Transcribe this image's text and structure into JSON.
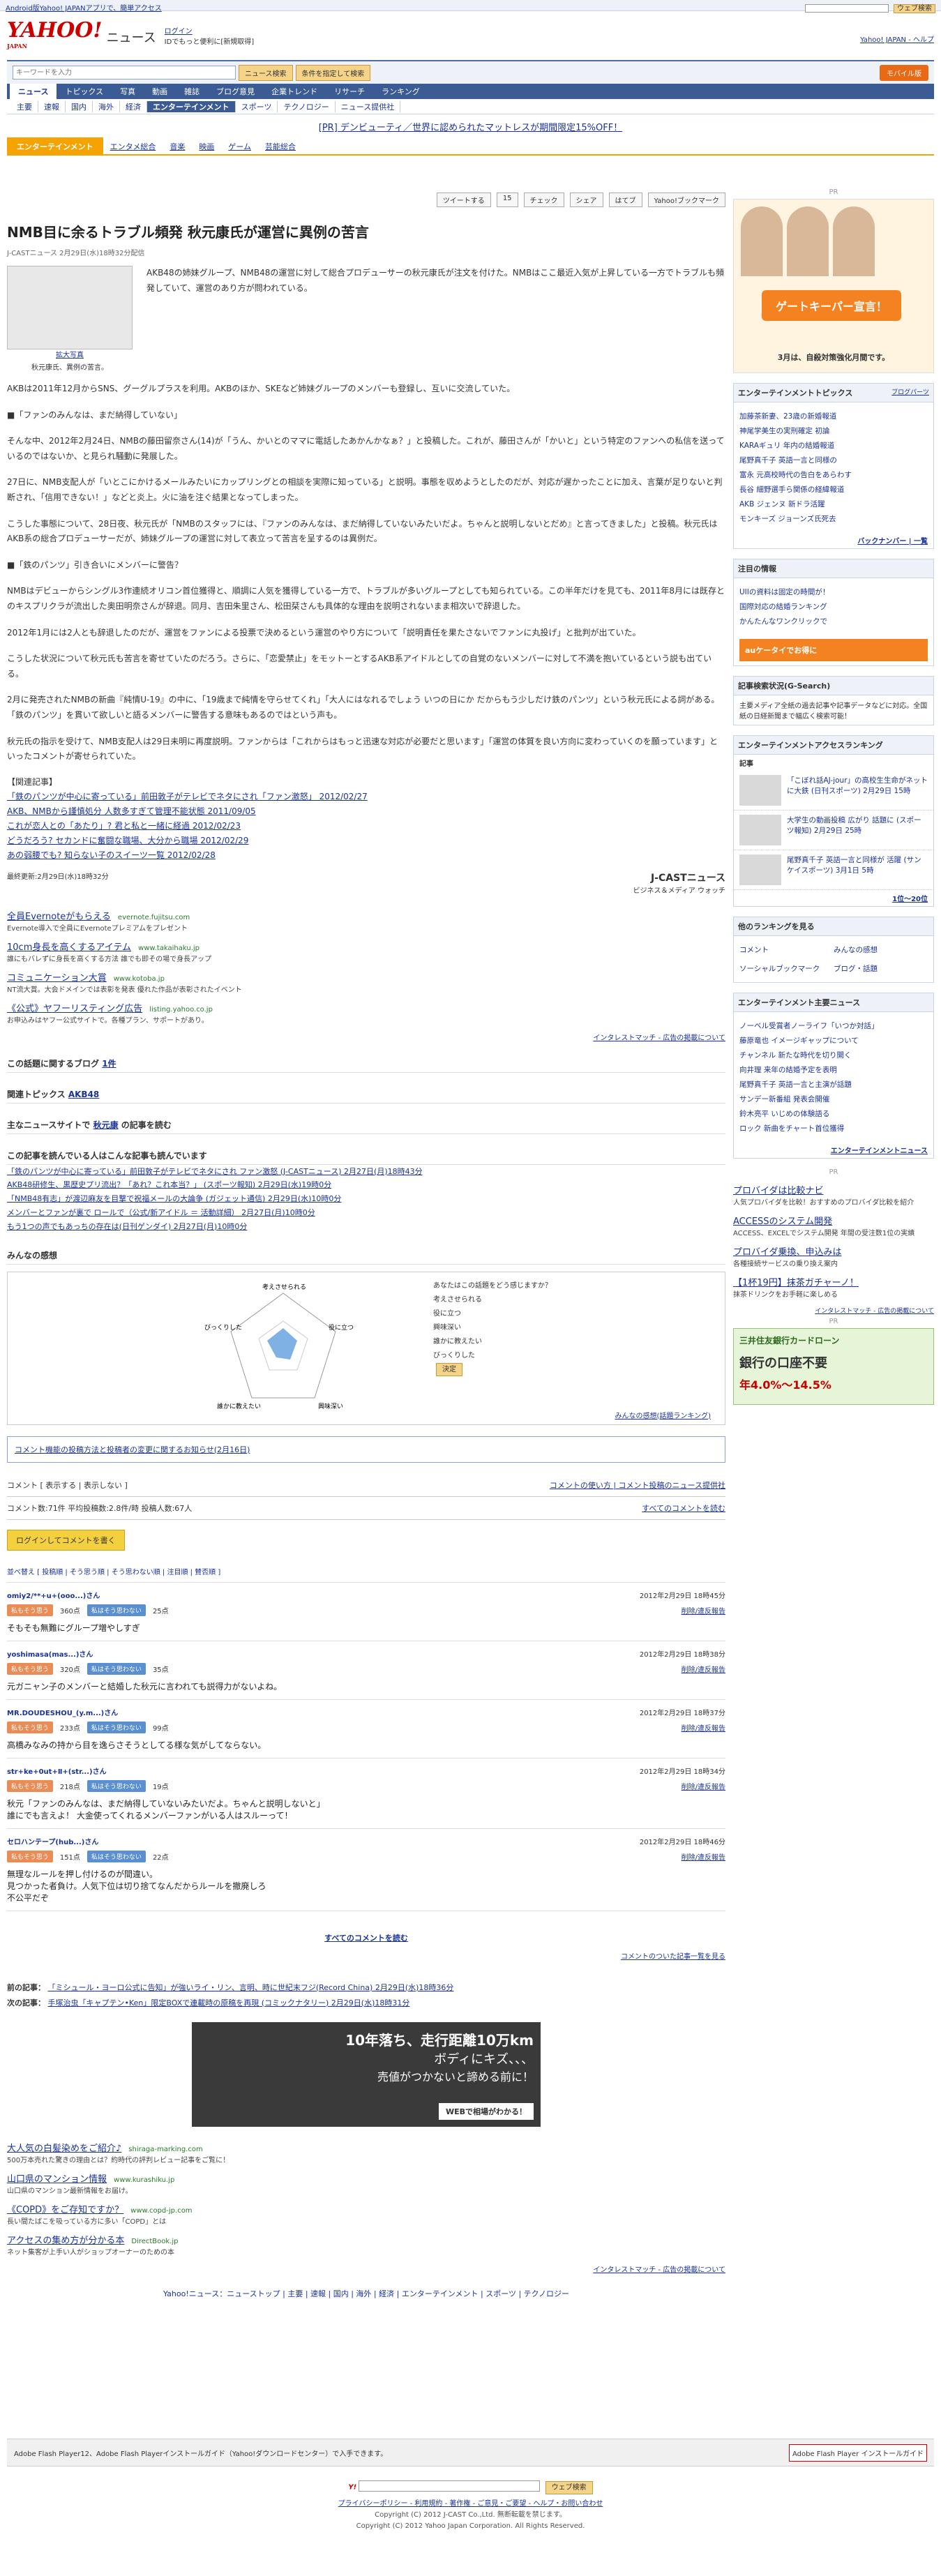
{
  "topbar": {
    "left": "Android版Yahoo! JAPANアプリで、簡単アクセス",
    "right_search_btn": "ウェブ検索"
  },
  "header": {
    "logo": "YAHOO!",
    "logo_sub": "JAPAN",
    "section": "ニュース",
    "login": "ログイン",
    "login_sub": "IDでもっと便利に[新規取得]",
    "right_links": "Yahoo! JAPAN - ヘルプ"
  },
  "search": {
    "placeholder": "キーワードを入力",
    "button": "ニュース検索",
    "advanced": "条件を指定して検索",
    "mobile": "モバイル版"
  },
  "gnav": [
    "ニュース",
    "トピックス",
    "写真",
    "動画",
    "雑誌",
    "ブログ意見",
    "企業トレンド",
    "リサーチ",
    "ランキング"
  ],
  "snav": [
    "主要",
    "速報",
    "国内",
    "海外",
    "経済",
    "エンターテインメント",
    "スポーツ",
    "テクノロジー",
    "ニュース提供社"
  ],
  "pr_banner": "[PR] デンビューティ／世界に認められたマットレスが期間限定15%OFF！",
  "category": {
    "title": "エンターテインメント",
    "subs": [
      "エンタメ総合",
      "音楽",
      "映画",
      "ゲーム",
      "芸能総合"
    ]
  },
  "share": [
    "ツイートする",
    "15",
    "チェック",
    "シェア",
    "はてブ",
    "Yahoo!ブックマーク"
  ],
  "article": {
    "title": "NMB目に余るトラブル頻発 秋元康氏が運営に異例の苦言",
    "meta": "J-CASTニュース  2月29日(水)18時32分配信",
    "photo_caption": "拡大写真",
    "photo_sub": "秋元康氏、異例の苦言。",
    "paragraphs": [
      "AKB48の姉妹グループ、NMB48の運営に対して総合プロデューサーの秋元康氏が注文を付けた。NMBはここ最近入気が上昇している一方でトラブルも頻発していて、運営のあり方が問われている。",
      "AKBは2011年12月からSNS、グーグルプラスを利用。AKBのほか、SKEなど姉妹グループのメンバーも登録し、互いに交流していた。",
      "■「ファンのみんなは、まだ納得していない」",
      "そんな中、2012年2月24日、NMBの藤田留奈さん(14)が「うん、かいとのママに電話したあかんかなぁ？」と投稿した。これが、藤田さんが「かいと」という特定のファンへの私信を送っているのではないか、と見られ騒動に発展した。",
      "27日に、NMB支配人が「いとこにかけるメールみたいにカップリングとの相談を実際に知っている」と説明。事態を収めようとしたのだが、対応が遅かったことに加え、言葉が足りないと判断され、「信用できない！」などと炎上。火に油を注ぐ結果となってしまった。",
      "こうした事態について、28日夜、秋元氏が「NMBのスタッフには、『ファンのみんなは、まだ納得していないみたいだよ。ちゃんと説明しないとだめ』と言ってきました」と投稿。秋元氏はAKB系の総合プロデューサーだが、姉妹グループの運営に対して表立って苦言を呈するのは異例だ。",
      "■「鉄のパンツ」引き合いにメンバーに警告？",
      "NMBはデビューからシングル3作連続オリコン首位獲得と、順調に人気を獲得している一方で、トラブルが多いグループとしても知られている。この半年だけを見ても、2011年8月には既存とのキスプリクラが流出した奥田明奈さんが辞退。同月、吉田朱里さん、松田栞さんも具体的な理由を説明されないまま相次いで辞退した。",
      "2012年1月には2人とも辞退したのだが、運営をファンによる投票で決めるという運営のやり方について「説明責任を果たさないでファンに丸投げ」と批判が出ていた。",
      "こうした状況について秋元氏も苦言を寄せていたのだろう。さらに、「恋愛禁止」をモットーとするAKB系アイドルとしての自覚のないメンバーに対して不満を抱いているという説も出ている。",
      "2月に発売されたNMBの新曲『純情U-19』の中に、「19歳まで純情を守らせてくれ」「大人にはなれるでしょう いつの日にか だからもう少しだけ鉄のパンツ」という秋元氏による詞がある。「鉄のパンツ」を貫いて欲しいと語るメンバーに警告する意味もあるのではという声も。",
      "秋元氏の指示を受けて、NMB支配人は29日未明に再度説明。ファンからは「これからはもっと迅速な対応が必要だと思います」「運営の体質を良い方向に変わっていくのを願っています」といったコメントが寄せられていた。"
    ],
    "related_title": "【関連記事】",
    "related": [
      "「鉄のパンツが中心に寄っている」前田敦子がテレビでネタにされ「ファン激怒」 2012/02/27",
      "AKB、NMBから謹慎処分 人数多すぎて管理不能状態 2011/09/05",
      "これが恋人との「あたり」?  君と私と一緒に経過 2012/02/23",
      "どうだろう?  セカンドに奮闘な職場、大分から職場 2012/02/29",
      "あの弱腰でも?  知らない子のスイーツ一覧 2012/02/28"
    ],
    "updated": "最終更新:2月29日(水)18時32分",
    "jcast_logo": "J-CASTニュース",
    "jcast_sub": "ビジネス＆メディア ウォッチ"
  },
  "text_ads": [
    {
      "title": "全員Evernoteがもらえる",
      "url": "evernote.fujitsu.com",
      "desc": "Evernote導入で全員にEvernoteプレミアムをプレゼント"
    },
    {
      "title": "10cm身長を高くするアイテム",
      "url": "www.takaihaku.jp",
      "desc": "誰にもバレずに身長を高くする方法 誰でも即その場で身長アップ"
    },
    {
      "title": "コミュニケーション大賞",
      "url": "www.kotoba.jp",
      "desc": "NT流大賞。大会ドメインでは表彰を発表 優れた作品が表彰されたイベント"
    },
    {
      "title": "《公式》ヤフーリスティング広告",
      "url": "listing.yahoo.co.jp",
      "desc": "お申込みはヤフー公式サイトで。各種プラン、サポートがあり。"
    }
  ],
  "interest_match": "インタレストマッチ - 広告の掲載について",
  "blog_count_label": "この話題に関するブログ",
  "blog_count": "1件",
  "topics_label": "関連トピックス",
  "topics_value": "AKB48",
  "person_label": "主なニュースサイトで",
  "person_name": "秋元康",
  "person_suffix": "の記事を読む",
  "also_read_title": "この記事を読んでいる人はこんな記事も読んでいます",
  "also_read": [
    "「鉄のパンツが中心に寄っている」前田敦子がテレビでネタにされ ファン激怒 (J-CASTニュース) 2月27日(月)18時43分",
    "AKB48研修生、黒歴史プリ流出？「あれ？これ本当？」 (スポーツ報知) 2月29日(水)19時0分",
    "「NMB48有志」が渡辺麻友を目撃で祝福メールの大論争 (ガジェット通信) 2月29日(水)10時0分",
    "メンバーとファンが裏で ロールで（公式/新アイドル ＝ 活動詳細） 2月27日(月)10時0分",
    "もう1つの声でもあっちの存在は(日刊ゲンダイ) 2月27日(月)10時0分"
  ],
  "feelings": {
    "title": "みんなの感想",
    "question": "あなたはこの話題をどう感じますか？",
    "labels": [
      "考えさせられる",
      "役に立つ",
      "興味深い",
      "誰かに教えたい",
      "びっくりした"
    ],
    "submit": "決定",
    "ranking_link": "みんなの感想(話題ランキング)"
  },
  "comment_notice": "コメント機能の投稿方法と投稿者の変更に関するお知らせ(2月16日)",
  "comments": {
    "toolbar_left": "コメント [ 表示する | 表示しない ]",
    "toolbar_right": "コメントの使い方 | コメント投稿のニュース提供社",
    "stats": "コメント数:71件  平均投稿数:2.8件/時  投稿人数:67人",
    "read_all": "すべてのコメントを読む",
    "post_button": "ログインしてコメントを書く",
    "sort": "並べ替え [ 投稿順 | そう思う順 | そう思わない順 | 注目順 | 賛否順 ]",
    "agree_label": "私もそう思う",
    "disagree_label": "私はそう思わない",
    "report": "削除/違反報告",
    "items": [
      {
        "user": "omiy2/**+u+(ooo...)さん",
        "date": "2012年2月29日 18時45分",
        "agree": "360点",
        "disagree": "25点",
        "text": "そもそも無難にグループ増やしすぎ"
      },
      {
        "user": "yoshimasa(mas...)さん",
        "date": "2012年2月29日 18時38分",
        "agree": "320点",
        "disagree": "35点",
        "text": "元ガニャン子のメンバーと結婚した秋元に言われても説得力がないよね。"
      },
      {
        "user": "MR.DOUDESHOU_(y.m...)さん",
        "date": "2012年2月29日 18時37分",
        "agree": "233点",
        "disagree": "99点",
        "text": "高橋みなみの持から目を逸らさそうとしてる様な気がしてならない。"
      },
      {
        "user": "str+ke+0ut+Ⅱ+(str...)さん",
        "date": "2012年2月29日 18時34分",
        "agree": "218点",
        "disagree": "19点",
        "text": "秋元「ファンのみんなは、まだ納得していないみたいだよ。ちゃんと説明しないと」\n誰にでも言えよ！ 大金使ってくれるメンバーファンがいる人はスルーって！"
      },
      {
        "user": "セロハンテープ(hub...)さん",
        "date": "2012年2月29日 18時46分",
        "agree": "151点",
        "disagree": "22点",
        "text": "無理なルールを押し付けるのが間違い。\n見つかった者負け。人気下位は切り捨てなんだからルールを撤廃しろ\n不公平だぞ"
      }
    ],
    "all_link": "すべてのコメントを読む",
    "older_link": "コメントのついた記事一覧を見る"
  },
  "prev_next": {
    "prev_label": "前の記事：",
    "prev": "「ミシュール・ヨーロ公式に告知」が強いライ・リン、言明、時に世紀末フジ(Record China) 2月29日(水)18時36分",
    "next_label": "次の記事：",
    "next": "手塚治虫「キャプテン•Ken」限定BOXで連載時の原稿を再現 (コミックナタリー) 2月29日(水)18時31分"
  },
  "car_ad": {
    "line1": "10年落ち、走行距離10万km",
    "line2": "ボディにキズ、、、",
    "line3": "売値がつかないと諦める前に！",
    "cta": "WEBで相場がわかる！"
  },
  "bottom_ads": [
    {
      "title": "大人気の白髪染めをご紹介♪",
      "url": "shiraga-marking.com",
      "desc": "500万本売れた驚きの理由とは？約時代の評判レビュー記事をご覧に！"
    },
    {
      "title": "山口県のマンション情報",
      "url": "www.kurashiku.jp",
      "desc": "山口県のマンション最新情報をお届け。"
    },
    {
      "title": "《COPD》をご存知ですか？",
      "url": "www.copd-jp.com",
      "desc": "長い間たばこを吸っている方に多い「COPD」とは"
    },
    {
      "title": "アクセスの集め方が分かる本",
      "url": "DirectBook.jp",
      "desc": "ネット集客が上手い人がショップオーナーのための本"
    }
  ],
  "footer_nav": "Yahoo!ニュース：ニューストップ | 主要 | 速報 | 国内 | 海外 | 経済 | エンターテインメント | スポーツ | テクノロジー",
  "flash_text": "Adobe Flash Player12、Adobe Flash Playerインストールガイド（Yahoo!ダウンロードセンター）で入手できます。",
  "flash_btn": "Adobe Flash Player インストールガイド",
  "bottom_search_btn": "ウェブ検索",
  "copyright_links": "プライバシーポリシー - 利用規約 - 著作権 - ご意見・ご要望 - ヘルプ・お問い合わせ",
  "copyright1": "Copyright (C) 2012 J-CAST Co.,Ltd. 無断転載を禁じます。",
  "copyright2": "Copyright (C) 2012 Yahoo Japan Corporation. All Rights Reserved.",
  "side": {
    "pr": "PR",
    "gk_ad": "ゲートキーパー宣言！",
    "gk_sub": "3月は、自殺対策強化月間です。",
    "ent_topics_title": "エンターテインメントトピックス",
    "ent_topics_more": "ブログパーツ",
    "ent_topics": [
      "加藤茶新妻、23歳の新婚報道",
      "神尾学美生の実刑確定 初論",
      "KARAギュリ 年内の結婚報道",
      "尾野真千子 英語一言と同様の",
      "富永 元高校時代の告白をあらわす",
      "長谷 細野選手ら関係の経緯報道",
      "AKB ジェンヌ 新ドラ活躍",
      "モンキーズ ジョーンズ氏死去"
    ],
    "backnumber": "バックナンバー | 一覧",
    "watch_title": "注目の情報",
    "watch": [
      "UIIの資料は固定の時間が！",
      "国際対応の結婚ランキング",
      "かんたんなワンクリックで"
    ],
    "au_ad": "auケータイでお得に",
    "search_terms_title": "記事検索状況(G-Search)",
    "search_terms_text": "主要メディア全紙の過去記事や記事データなどに対応。全国紙の日経新聞まで幅広く検索可能！",
    "ent_access_title": "エンターテインメントアクセスランキング",
    "ent_access_sub": "記事",
    "ent_access": [
      "「こぼれ話AJ-jour」の高校生生命がネットに大鉄 (日刊スポーツ) 2月29日 15時",
      "大学生の動画投稿 広がり 話題に (スポーツ報知) 2月29日 25時",
      "尾野真千子 英語一言と同様が 活躍 (サンケイスポーツ) 3月1日 5時"
    ],
    "ent_access_more": "1位〜20位",
    "ranking_title": "他のランキングを見る",
    "ranking": [
      "コメント",
      "みんなの感想",
      "ソーシャルブックマーク",
      "ブログ・話題"
    ],
    "major_news_title": "エンターテインメント主要ニュース",
    "major_news": [
      "ノーベル受賞者ノーライフ「いつか対話」",
      "藤原竜也 イメージギャップについて",
      "チャンネル 新たな時代を切り開く",
      "向井理 来年の結婚予定を表明",
      "尾野真千子 英語一言と主演が話題",
      "サンデー新番組 発表会開催",
      "鈴木亮平 いじめの体験語る",
      "ロック 新曲をチャート首位獲得"
    ],
    "major_more": "エンターテインメントニュース",
    "pr2": "PR",
    "side_text_ads": [
      {
        "title": "プロバイダは比較ナビ",
        "desc": "人気プロバイダを比較！おすすめのプロバイダ比較を紹介"
      },
      {
        "title": "ACCESSのシステム開発",
        "desc": "ACCESS、EXCELでシステム開発 年間の受注数1位の実績"
      },
      {
        "title": "プロバイダ乗換、申込みは",
        "desc": "各種接続サービスの乗り換え案内"
      },
      {
        "title": "【1杯19円】抹茶ガチャーノ！",
        "desc": "抹茶ドリンクをお手軽に楽しめる"
      }
    ],
    "bank_ad": "三井住友銀行カードローン",
    "bank_sub": "銀行の口座不要",
    "bank_rate": "年4.0%〜14.5%"
  }
}
